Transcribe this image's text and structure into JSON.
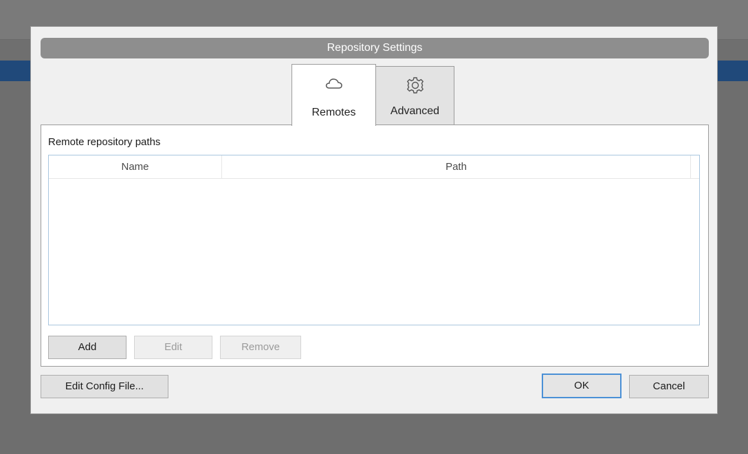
{
  "dialog": {
    "title": "Repository Settings"
  },
  "tabs": [
    {
      "label": "Remotes",
      "icon": "cloud-icon",
      "active": true
    },
    {
      "label": "Advanced",
      "icon": "gear-icon",
      "active": false
    }
  ],
  "remotes": {
    "section_label": "Remote repository paths",
    "columns": [
      "Name",
      "Path"
    ],
    "rows": [],
    "buttons": {
      "add": "Add",
      "edit": "Edit",
      "remove": "Remove"
    }
  },
  "footer": {
    "edit_config": "Edit Config File...",
    "ok": "OK",
    "cancel": "Cancel"
  },
  "colors": {
    "title_bar": "#8e8e8e",
    "background_blue": "#20497a",
    "ok_focus_border": "#4a90d6",
    "table_border": "#a9c6de"
  }
}
